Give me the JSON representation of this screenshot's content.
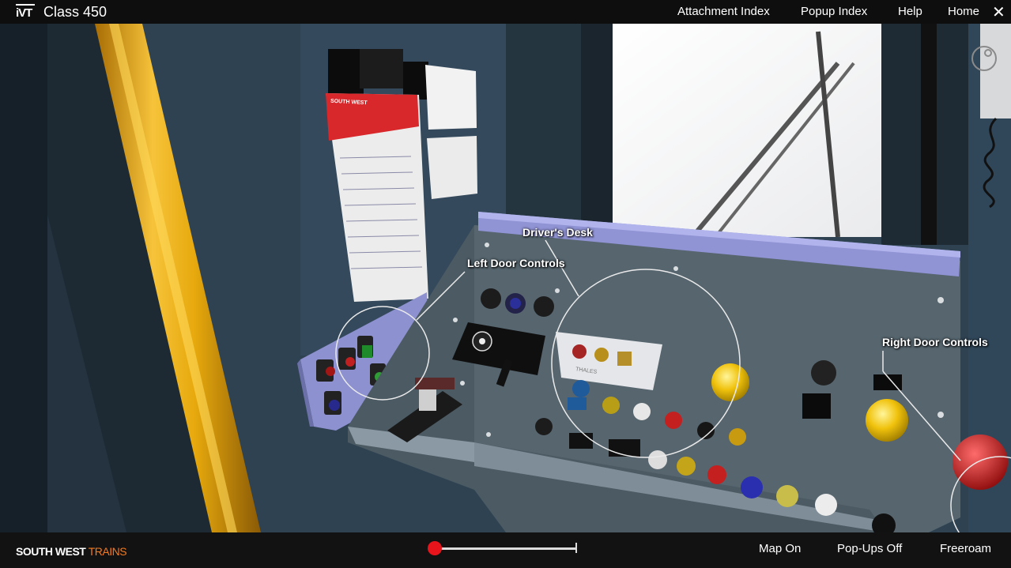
{
  "header": {
    "logo_text": "iVT",
    "title": "Class 450",
    "nav": [
      "Attachment Index",
      "Popup Index",
      "Help",
      "Home"
    ],
    "close_glyph": "✕"
  },
  "scene": {
    "callouts": {
      "drivers_desk": "Driver's Desk",
      "left_door_controls": "Left Door Controls",
      "right_door_controls": "Right Door Controls"
    },
    "poster_brand": "SOUTH WEST",
    "panel_brand": "THALES"
  },
  "footer": {
    "brand_part1": "SOUTH WEST",
    "brand_part2": "TRAINS",
    "timeline_position": 0,
    "buttons": [
      "Map On",
      "Pop-Ups Off",
      "Freeroam"
    ]
  },
  "colors": {
    "accent_red": "#e8141b",
    "brand_orange": "#f47a20",
    "bar_background": "#0e0e0e",
    "desk_grey": "#4b5a63",
    "side_panel_lavender": "#8d91cf",
    "frame_yellow": "#e7a90d"
  },
  "icons": [
    "close-icon",
    "orbit-icon"
  ]
}
